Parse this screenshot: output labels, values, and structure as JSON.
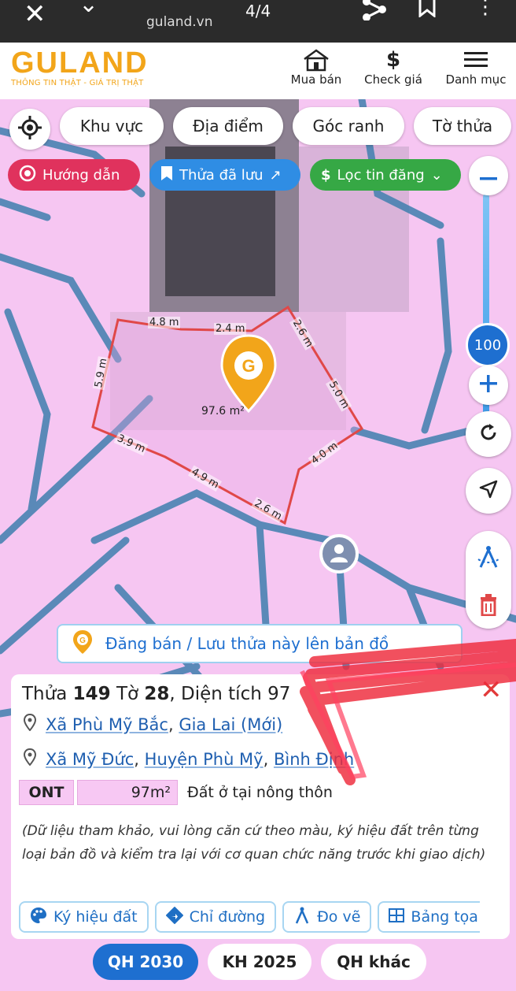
{
  "browser": {
    "close_glyph": "✕",
    "chevron_glyph": "⌄",
    "url": "guland.vn",
    "pager": "4/4",
    "more_glyph": "⋮"
  },
  "header": {
    "logo": "GULAND",
    "tagline": "THÔNG TIN THẬT - GIÁ TRỊ THẬT",
    "buy_sell": "Mua bán",
    "check_price": "Check giá",
    "category": "Danh mục",
    "price_glyph": "$"
  },
  "map": {
    "filters": [
      "Khu vực",
      "Địa điểm",
      "Góc ranh",
      "Tờ thửa"
    ],
    "chips": {
      "guide": "Hướng dẫn",
      "saved": "Thửa đã lưu",
      "saved_arrow": "↗",
      "filter_prefix": "$",
      "filter": "Lọc tin đăng",
      "filter_chevron": "⌄"
    },
    "zoom_level": "100",
    "edge_labels": [
      "4.8 m",
      "2.4 m",
      "2.6 m",
      "5.9 m",
      "5.0 m",
      "3.9 m",
      "4.0 m",
      "4.9 m",
      "2.6 m"
    ],
    "area": "97.6 m²",
    "post_banner": "Đăng bán / Lưu thửa này lên bản đồ"
  },
  "panel": {
    "title_prefix": "Thửa",
    "parcel": "149",
    "sheet_prefix": "Tờ",
    "sheet": "28",
    "area_label": ", Diện tích 97",
    "addr1": {
      "commune": "Xã Phù Mỹ Bắc",
      "province": "Gia Lai (Mới)"
    },
    "addr2": {
      "commune": "Xã Mỹ Đức",
      "district": "Huyện Phù Mỹ",
      "province": "Bình Định"
    },
    "separator": ",",
    "land_code": "ONT",
    "land_area": "97m²",
    "land_type": "Đất ở tại nông thôn",
    "note": "(Dữ liệu tham khảo, vui lòng căn cứ theo màu, ký hiệu đất trên từng loại bản đồ và kiểm tra lại với cơ quan chức năng trước khi giao dịch)",
    "actions": [
      "Ký hiệu đất",
      "Chỉ đường",
      "Đo vẽ",
      "Bảng tọa"
    ],
    "close_glyph": "✕"
  },
  "tabs": [
    "QH 2030",
    "KH 2025",
    "QH khác"
  ],
  "colors": {
    "brand": "#f2a51a",
    "map_land": "#f6c6f2",
    "road": "#3f7fae",
    "parcel_outline": "#e04848",
    "primary": "#1e6fd0"
  }
}
